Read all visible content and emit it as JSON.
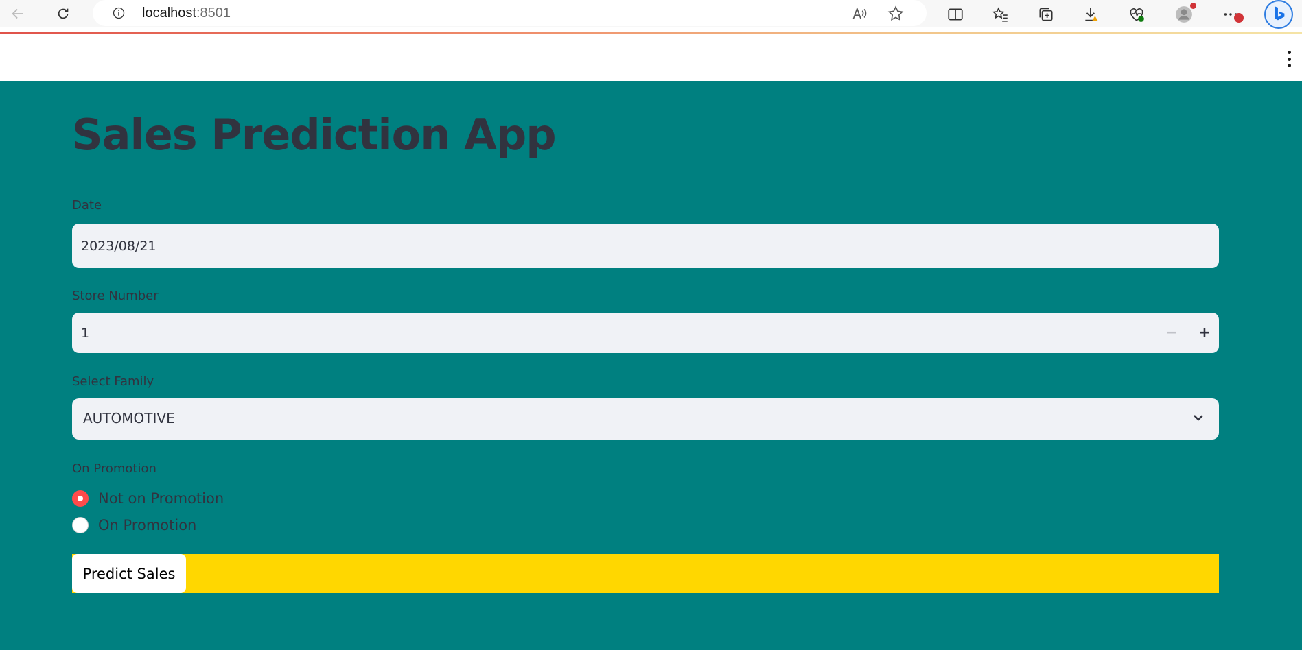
{
  "browser": {
    "url_host": "localhost",
    "url_port": ":8501",
    "icons": [
      "back-icon",
      "refresh-icon",
      "info-icon",
      "read-aloud-icon",
      "favorite-star-icon",
      "split-screen-icon",
      "favorites-icon",
      "collections-icon",
      "downloads-icon",
      "browser-essentials-icon",
      "profile-icon",
      "more-icon",
      "bing-icon"
    ]
  },
  "app": {
    "title": "Sales Prediction App",
    "date": {
      "label": "Date",
      "value": "2023/08/21"
    },
    "store": {
      "label": "Store Number",
      "value": "1",
      "minus": "−",
      "plus": "+"
    },
    "family": {
      "label": "Select Family",
      "value": "AUTOMOTIVE"
    },
    "promotion": {
      "label": "On Promotion",
      "options": [
        "Not on Promotion",
        "On Promotion"
      ],
      "selected": "Not on Promotion"
    },
    "predict_label": "Predict Sales"
  },
  "colors": {
    "main_bg": "#008080",
    "input_bg": "#f0f2f6",
    "text": "#31333f",
    "radio_selected": "#ff4b4b",
    "predict_bar": "#ffd700"
  }
}
